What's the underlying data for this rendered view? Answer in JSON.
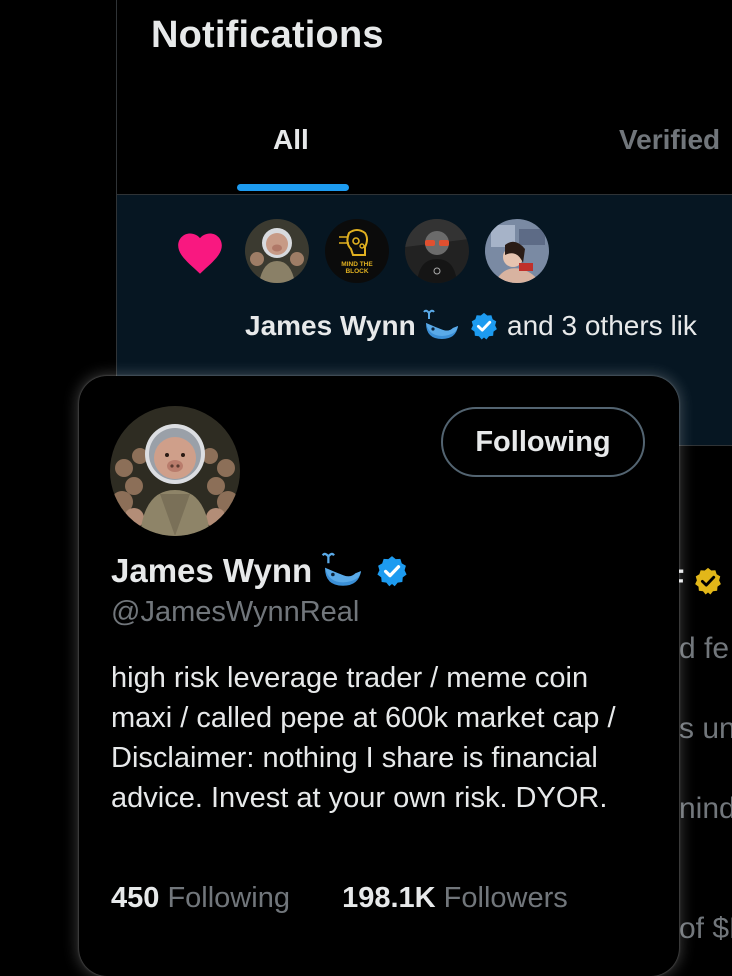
{
  "header": {
    "title": "Notifications"
  },
  "tabs": [
    {
      "label": "All"
    },
    {
      "label": "Verified"
    }
  ],
  "notification": {
    "name": "James Wynn",
    "text": "and 3 others lik",
    "avatars": [
      {
        "name": "pig-astronaut-avatar"
      },
      {
        "name": "mind-the-block-avatar",
        "text1": "MIND THE",
        "text2": "BLOCK"
      },
      {
        "name": "sunglasses-avatar"
      },
      {
        "name": "photo-avatar"
      }
    ]
  },
  "background_rows": {
    "r1": "F",
    "r2": "d fe",
    "r3": "s uni",
    "r4": "nind",
    "r5": "of $F"
  },
  "hover_card": {
    "follow_button": "Following",
    "name": "James Wynn",
    "handle": "@JamesWynnReal",
    "bio": "high risk leverage trader / meme coin maxi / called pepe at 600k market cap / Disclaimer: nothing I share is financial advice. Invest at your own risk. DYOR.",
    "following_count": "450",
    "following_label": "Following",
    "followers_count": "198.1K",
    "followers_label": "Followers"
  },
  "colors": {
    "accent": "#1d9bf0",
    "like": "#f91880",
    "verified_gold": "#e2b719"
  }
}
